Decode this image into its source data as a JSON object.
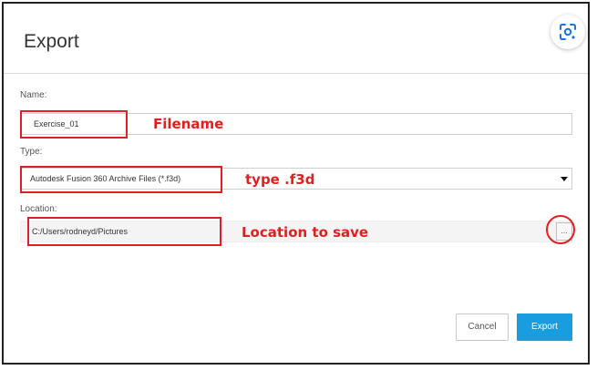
{
  "dialog": {
    "title": "Export"
  },
  "fields": {
    "name": {
      "label": "Name:",
      "value": "Exercise_01"
    },
    "type": {
      "label": "Type:",
      "value": "Autodesk Fusion 360 Archive Files (*.f3d)"
    },
    "location": {
      "label": "Location:",
      "value": "C:/Users/rodneyd/Pictures",
      "browse_label": "..."
    }
  },
  "annotations": {
    "filename": "Filename",
    "type": "type .f3d",
    "location": "Location to save"
  },
  "buttons": {
    "cancel": "Cancel",
    "export": "Export"
  },
  "icons": {
    "lens": "google-lens-icon",
    "dropdown": "chevron-down-icon"
  },
  "colors": {
    "accent": "#1a9de0",
    "annotation": "#e02020"
  }
}
